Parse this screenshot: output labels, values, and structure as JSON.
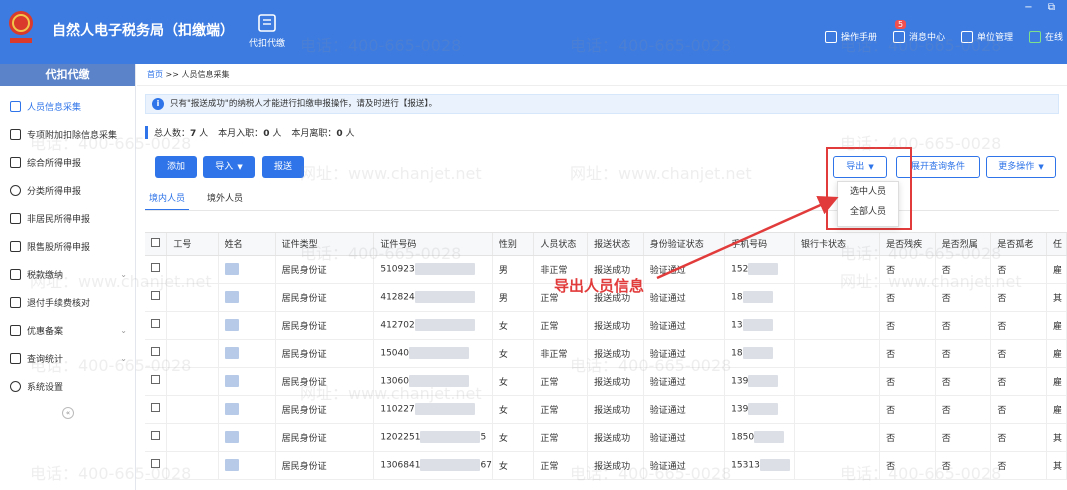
{
  "header": {
    "app_title": "自然人电子税务局（扣缴端）",
    "top_tab_label": "代扣代缴",
    "actions": [
      {
        "label": "操作手册",
        "icon": "manual-icon"
      },
      {
        "label": "消息中心",
        "icon": "message-icon",
        "badge": "5"
      },
      {
        "label": "单位管理",
        "icon": "unit-icon"
      },
      {
        "label": "在线",
        "icon": "online-icon"
      }
    ],
    "window_controls": "− ⧉"
  },
  "sidebar": {
    "title": "代扣代缴",
    "items": [
      {
        "label": "人员信息采集",
        "active": true
      },
      {
        "label": "专项附加扣除信息采集"
      },
      {
        "label": "综合所得申报"
      },
      {
        "label": "分类所得申报"
      },
      {
        "label": "非居民所得申报"
      },
      {
        "label": "限售股所得申报"
      },
      {
        "label": "税款缴纳",
        "chevron": "⌄"
      },
      {
        "label": "退付手续费核对"
      },
      {
        "label": "优惠备案",
        "chevron": "⌄"
      },
      {
        "label": "查询统计",
        "chevron": "⌄"
      },
      {
        "label": "系统设置"
      }
    ],
    "collapse": "«"
  },
  "breadcrumb": {
    "home": "首页",
    "sep": ">>",
    "current": "人员信息采集"
  },
  "notice": {
    "icon": "i",
    "text": "只有\"报送成功\"的纳税人才能进行扣缴申报操作，请及时进行【报送】。"
  },
  "stats": {
    "total_label": "总人数：",
    "total": "7",
    "total_unit": "人",
    "month_in_label": "本月入职：",
    "month_in": "0",
    "month_in_unit": "人",
    "month_out_label": "本月离职：",
    "month_out": "0",
    "month_out_unit": "人"
  },
  "toolbar": {
    "add": "添加",
    "import": "导入",
    "submit": "报送",
    "export": "导出",
    "expand_query": "展开查询条件",
    "more": "更多操作"
  },
  "export_menu": [
    "选中人员",
    "全部人员"
  ],
  "annotation": "导出人员信息",
  "tabs": [
    "境内人员",
    "境外人员"
  ],
  "table": {
    "columns": [
      "工号",
      "姓名",
      "证件类型",
      "证件号码",
      "性别",
      "人员状态",
      "报送状态",
      "身份验证状态",
      "手机号码",
      "银行卡状态",
      "是否残疾",
      "是否烈属",
      "是否孤老",
      "任"
    ],
    "rows": [
      {
        "id_type": "居民身份证",
        "id_no": "510923",
        "gender": "男",
        "status": "非正常",
        "submit": "报送成功",
        "verify": "验证通过",
        "phone": "152",
        "disabled": "否",
        "martyr": "否",
        "elder": "否",
        "extra": "雇"
      },
      {
        "id_type": "居民身份证",
        "id_no": "412824",
        "gender": "男",
        "status": "正常",
        "submit": "报送成功",
        "verify": "验证通过",
        "phone": "18",
        "disabled": "否",
        "martyr": "否",
        "elder": "否",
        "extra": "其"
      },
      {
        "id_type": "居民身份证",
        "id_no": "412702",
        "gender": "女",
        "status": "正常",
        "submit": "报送成功",
        "verify": "验证通过",
        "phone": "13",
        "disabled": "否",
        "martyr": "否",
        "elder": "否",
        "extra": "雇"
      },
      {
        "id_type": "居民身份证",
        "id_no": "15040",
        "gender": "女",
        "status": "非正常",
        "submit": "报送成功",
        "verify": "验证通过",
        "phone": "18",
        "disabled": "否",
        "martyr": "否",
        "elder": "否",
        "extra": "雇"
      },
      {
        "id_type": "居民身份证",
        "id_no": "13060",
        "gender": "女",
        "status": "正常",
        "submit": "报送成功",
        "verify": "验证通过",
        "phone": "139",
        "disabled": "否",
        "martyr": "否",
        "elder": "否",
        "extra": "雇"
      },
      {
        "id_type": "居民身份证",
        "id_no": "110227",
        "gender": "女",
        "status": "正常",
        "submit": "报送成功",
        "verify": "验证通过",
        "phone": "139",
        "disabled": "否",
        "martyr": "否",
        "elder": "否",
        "extra": "雇"
      },
      {
        "id_type": "居民身份证",
        "id_no": "1202251",
        "id_tail": "5",
        "gender": "女",
        "status": "正常",
        "submit": "报送成功",
        "verify": "验证通过",
        "phone": "1850",
        "disabled": "否",
        "martyr": "否",
        "elder": "否",
        "extra": "其"
      },
      {
        "id_type": "居民身份证",
        "id_no": "1306841",
        "id_tail": "67",
        "gender": "女",
        "status": "正常",
        "submit": "报送成功",
        "verify": "验证通过",
        "phone": "15313",
        "disabled": "否",
        "martyr": "否",
        "elder": "否",
        "extra": "其"
      }
    ]
  },
  "watermark": {
    "phone": "电话：400-665-0028",
    "site": "网址：www.chanjet.net"
  },
  "colors": {
    "header_bg": "#3d7be0",
    "primary": "#2f74e8",
    "annotation": "#e23b3b"
  }
}
